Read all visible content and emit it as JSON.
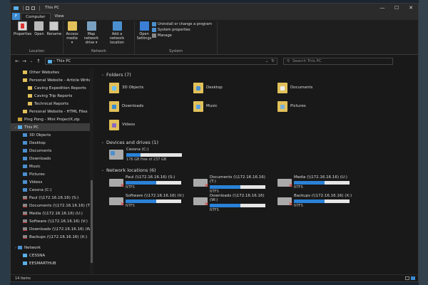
{
  "window": {
    "title": "This PC",
    "minimize_glyph": "—",
    "maximize_glyph": "☐",
    "close_glyph": "✕"
  },
  "ribbon_tabs": {
    "file": "F",
    "computer": "Computer",
    "view": "View"
  },
  "ribbon": {
    "location": {
      "label": "Location",
      "buttons": [
        "Properties",
        "Open",
        "Rename"
      ]
    },
    "network": {
      "label": "Network",
      "buttons": [
        "Access media ▾",
        "Map network drive ▾",
        "Add a network location"
      ]
    },
    "system": {
      "label": "System",
      "open_settings": "Open Settings",
      "items": [
        "Uninstall or change a program",
        "System properties",
        "Manage"
      ]
    }
  },
  "address": {
    "path": "This PC",
    "separator": "›",
    "search_placeholder": "Search This PC"
  },
  "nav": {
    "items": [
      {
        "label": "Other Websites",
        "icon": "folder-icon",
        "indent": 1
      },
      {
        "label": "Personal Website - Article Write",
        "icon": "folder-icon",
        "indent": 1
      },
      {
        "label": "Caving Expedition Reports",
        "icon": "folder-icon",
        "indent": 2
      },
      {
        "label": "Caving Trip Reports",
        "icon": "folder-icon",
        "indent": 2
      },
      {
        "label": "Technical Reports",
        "icon": "folder-icon",
        "indent": 2
      },
      {
        "label": "Personal Website - HTML Files",
        "icon": "folder-icon",
        "indent": 1
      },
      {
        "label": "Ping Pong - Mini ProjectX.zip",
        "icon": "zip-icon",
        "indent": 0
      },
      {
        "label": "This PC",
        "icon": "pc-icon",
        "indent": 0,
        "chevron": "⌄",
        "selected": true
      },
      {
        "label": "3D Objects",
        "icon": "blue-icon",
        "indent": 1
      },
      {
        "label": "Desktop",
        "icon": "blue-icon",
        "indent": 1
      },
      {
        "label": "Documents",
        "icon": "blue-icon",
        "indent": 1
      },
      {
        "label": "Downloads",
        "icon": "blue-icon",
        "indent": 1
      },
      {
        "label": "Music",
        "icon": "blue-icon",
        "indent": 1
      },
      {
        "label": "Pictures",
        "icon": "blue-icon",
        "indent": 1
      },
      {
        "label": "Videos",
        "icon": "blue-icon",
        "indent": 1
      },
      {
        "label": "Cessna (C:)",
        "icon": "drive-icon",
        "indent": 1
      },
      {
        "label": "Paul (\\\\172.16.16.16) (S:)",
        "icon": "net-icon",
        "indent": 1
      },
      {
        "label": "Documents (\\\\172.16.16.16) (T:)",
        "icon": "net-icon",
        "indent": 1
      },
      {
        "label": "Media (\\\\172.16.16.16) (U:)",
        "icon": "net-icon",
        "indent": 1
      },
      {
        "label": "Software (\\\\172.16.16.16) (V:)",
        "icon": "net-icon",
        "indent": 1
      },
      {
        "label": "Downloads (\\\\172.16.16.16) (W:)",
        "icon": "net-icon",
        "indent": 1
      },
      {
        "label": "Backups (\\\\172.16.16.16) (X:)",
        "icon": "net-icon",
        "indent": 1
      },
      {
        "label": "",
        "icon": "",
        "indent": 0,
        "spacer": true
      },
      {
        "label": "Network",
        "icon": "network-icon",
        "indent": 0,
        "chevron": "›"
      },
      {
        "label": "CESSNA",
        "icon": "pc-icon",
        "indent": 1
      },
      {
        "label": "EESMARTHUB",
        "icon": "pc-icon",
        "indent": 1
      }
    ]
  },
  "folders": {
    "header": "Folders (7)",
    "chevron": "⌄",
    "items": [
      {
        "label": "3D Objects",
        "overlay": "#6cc0f0"
      },
      {
        "label": "Desktop",
        "overlay": "#4a90d0"
      },
      {
        "label": "Documents",
        "overlay": "#eeeeee"
      },
      {
        "label": "Downloads",
        "overlay": "#3a8ad0"
      },
      {
        "label": "Music",
        "overlay": "#5aa0e0"
      },
      {
        "label": "Pictures",
        "overlay": "#7ab0d8"
      },
      {
        "label": "Videos",
        "overlay": "#8a6ac0"
      }
    ]
  },
  "drives": {
    "header": "Devices and drives (1)",
    "chevron": "⌄",
    "items": [
      {
        "label": "Cessna (C:)",
        "free": "176 GB free of 237 GB",
        "used_fraction": 0.26
      }
    ]
  },
  "network": {
    "header": "Network locations (6)",
    "chevron": "⌄",
    "items": [
      {
        "label": "Paul (\\\\172.16.16.16) (S:)",
        "fs": "NTFS",
        "used_fraction": 0.55
      },
      {
        "label": "Documents (\\\\172.16.16.16) (T:)",
        "fs": "NTFS",
        "used_fraction": 0.55
      },
      {
        "label": "Media (\\\\172.16.16.16) (U:)",
        "fs": "NTFS",
        "used_fraction": 0.55
      },
      {
        "label": "Software (\\\\172.16.16.16) (V:)",
        "fs": "NTFS",
        "used_fraction": 0.55
      },
      {
        "label": "Downloads (\\\\172.16.16.16) (W:)",
        "fs": "NTFS",
        "used_fraction": 0.55
      },
      {
        "label": "Backups (\\\\172.16.16.16) (X:)",
        "fs": "NTFS",
        "used_fraction": 0.55
      }
    ],
    "disconnected_mark": "✕"
  },
  "status": {
    "count": "14 items"
  }
}
